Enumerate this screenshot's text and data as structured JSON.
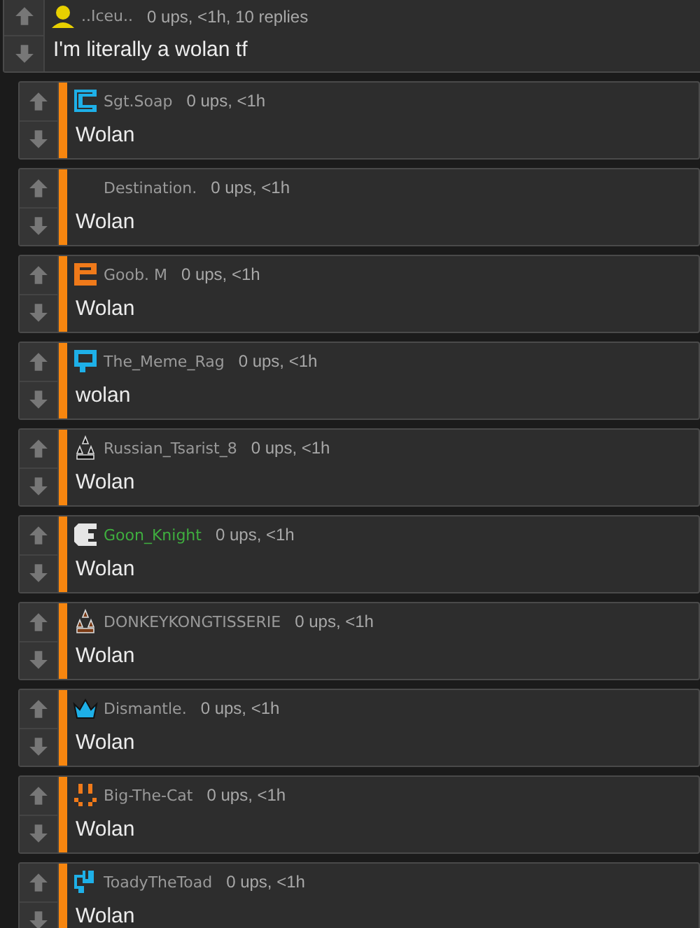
{
  "comment": {
    "avatar": {
      "kind": "person",
      "color": "#e8d000"
    },
    "user": "..Iceu..",
    "color": "#9a9a9a",
    "meta": "0 ups, <1h, 10 replies",
    "text": "I'm literally a wolan tf"
  },
  "replies": [
    {
      "avatar": {
        "kind": "c-block",
        "color": "#1eb0e8"
      },
      "user": "Sgt.Soap",
      "color": "#9a9a9a",
      "meta": "0 ups, <1h",
      "text": "Wolan"
    },
    {
      "avatar": {
        "kind": "blank"
      },
      "user": "Destination.",
      "color": "#9a9a9a",
      "meta": "0 ups, <1h",
      "text": "Wolan"
    },
    {
      "avatar": {
        "kind": "e-block",
        "color": "#f07a1a"
      },
      "user": "Goob.  M",
      "color": "#9a9a9a",
      "meta": "0 ups, <1h",
      "text": "Wolan"
    },
    {
      "avatar": {
        "kind": "flag",
        "color": "#1eb0e8"
      },
      "user": "The_Meme_Rag",
      "color": "#9a9a9a",
      "meta": "0 ups, <1h",
      "text": "wolan"
    },
    {
      "avatar": {
        "kind": "stars",
        "color": "#111111"
      },
      "user": "Russian_Tsarist_8",
      "color": "#9a9a9a",
      "meta": "0 ups, <1h",
      "text": "Wolan"
    },
    {
      "avatar": {
        "kind": "chomper",
        "color": "#e6e6e6"
      },
      "user": "Goon_Knight",
      "color": "#3fae3f",
      "meta": "0 ups, <1h",
      "text": "Wolan"
    },
    {
      "avatar": {
        "kind": "stars",
        "color": "#7a3a14"
      },
      "user": "DONKEYKONGTISSERIE",
      "color": "#9a9a9a",
      "meta": "0 ups, <1h",
      "text": "Wolan"
    },
    {
      "avatar": {
        "kind": "crown",
        "color": "#1eb0e8"
      },
      "user": "Dismantle.",
      "color": "#9a9a9a",
      "meta": "0 ups, <1h",
      "text": "Wolan"
    },
    {
      "avatar": {
        "kind": "smile",
        "color": "#f07a1a"
      },
      "user": "Big-The-Cat",
      "color": "#9a9a9a",
      "meta": "0 ups, <1h",
      "text": "Wolan"
    },
    {
      "avatar": {
        "kind": "toad",
        "color": "#1eb0e8"
      },
      "user": "ToadyTheToad",
      "color": "#9a9a9a",
      "meta": "0 ups, <1h",
      "text": "Wolan"
    }
  ]
}
